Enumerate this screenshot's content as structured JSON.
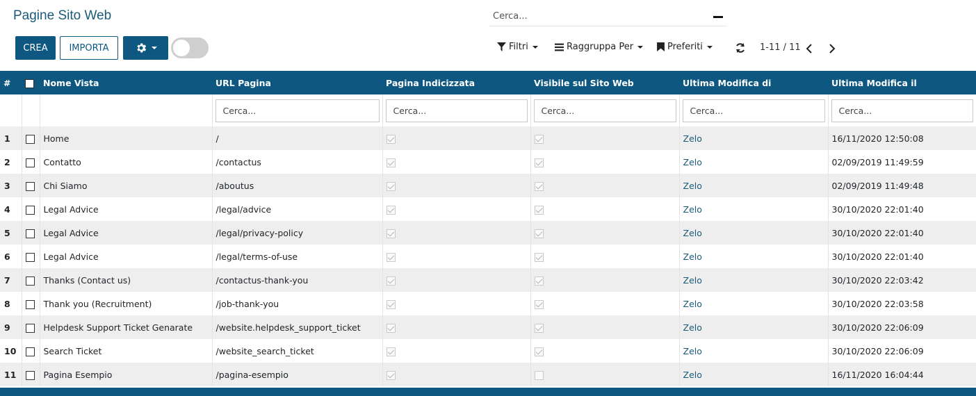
{
  "page": {
    "title": "Pagine Sito Web"
  },
  "search": {
    "placeholder": "Cerca..."
  },
  "toolbar": {
    "create_label": "CREA",
    "import_label": "IMPORTA",
    "filters_label": "Filtri",
    "group_by_label": "Raggruppa Per",
    "favorites_label": "Preferiti",
    "pager": "1-11 / 11"
  },
  "colors": {
    "primary": "#0d5781",
    "link": "#1b5a7a",
    "row_alt": "#eeeeee"
  },
  "table": {
    "columns": [
      "#",
      "Nome Vista",
      "URL Pagina",
      "Pagina Indicizzata",
      "Visibile sul Sito Web",
      "Ultima Modifica di",
      "Ultima Modifica il"
    ],
    "filter_placeholder": "Cerca...",
    "rows": [
      {
        "num": "1",
        "name": "Home",
        "url": "/",
        "indexed": true,
        "visible": true,
        "modified_by": "Zelo",
        "modified_on": "16/11/2020 12:50:08"
      },
      {
        "num": "2",
        "name": "Contatto",
        "url": "/contactus",
        "indexed": true,
        "visible": true,
        "modified_by": "Zelo",
        "modified_on": "02/09/2019 11:49:59"
      },
      {
        "num": "3",
        "name": "Chi Siamo",
        "url": "/aboutus",
        "indexed": true,
        "visible": true,
        "modified_by": "Zelo",
        "modified_on": "02/09/2019 11:49:48"
      },
      {
        "num": "4",
        "name": "Legal Advice",
        "url": "/legal/advice",
        "indexed": true,
        "visible": true,
        "modified_by": "Zelo",
        "modified_on": "30/10/2020 22:01:40"
      },
      {
        "num": "5",
        "name": "Legal Advice",
        "url": "/legal/privacy-policy",
        "indexed": true,
        "visible": true,
        "modified_by": "Zelo",
        "modified_on": "30/10/2020 22:01:40"
      },
      {
        "num": "6",
        "name": "Legal Advice",
        "url": "/legal/terms-of-use",
        "indexed": true,
        "visible": true,
        "modified_by": "Zelo",
        "modified_on": "30/10/2020 22:01:40"
      },
      {
        "num": "7",
        "name": "Thanks (Contact us)",
        "url": "/contactus-thank-you",
        "indexed": true,
        "visible": true,
        "modified_by": "Zelo",
        "modified_on": "30/10/2020 22:03:42"
      },
      {
        "num": "8",
        "name": "Thank you (Recruitment)",
        "url": "/job-thank-you",
        "indexed": true,
        "visible": true,
        "modified_by": "Zelo",
        "modified_on": "30/10/2020 22:03:58"
      },
      {
        "num": "9",
        "name": "Helpdesk Support Ticket Genarate",
        "url": "/website.helpdesk_support_ticket",
        "indexed": true,
        "visible": true,
        "modified_by": "Zelo",
        "modified_on": "30/10/2020 22:06:09"
      },
      {
        "num": "10",
        "name": "Search Ticket",
        "url": "/website_search_ticket",
        "indexed": true,
        "visible": true,
        "modified_by": "Zelo",
        "modified_on": "30/10/2020 22:06:09"
      },
      {
        "num": "11",
        "name": "Pagina Esempio",
        "url": "/pagina-esempio",
        "indexed": true,
        "visible": false,
        "modified_by": "Zelo",
        "modified_on": "16/11/2020 16:04:44"
      }
    ]
  }
}
